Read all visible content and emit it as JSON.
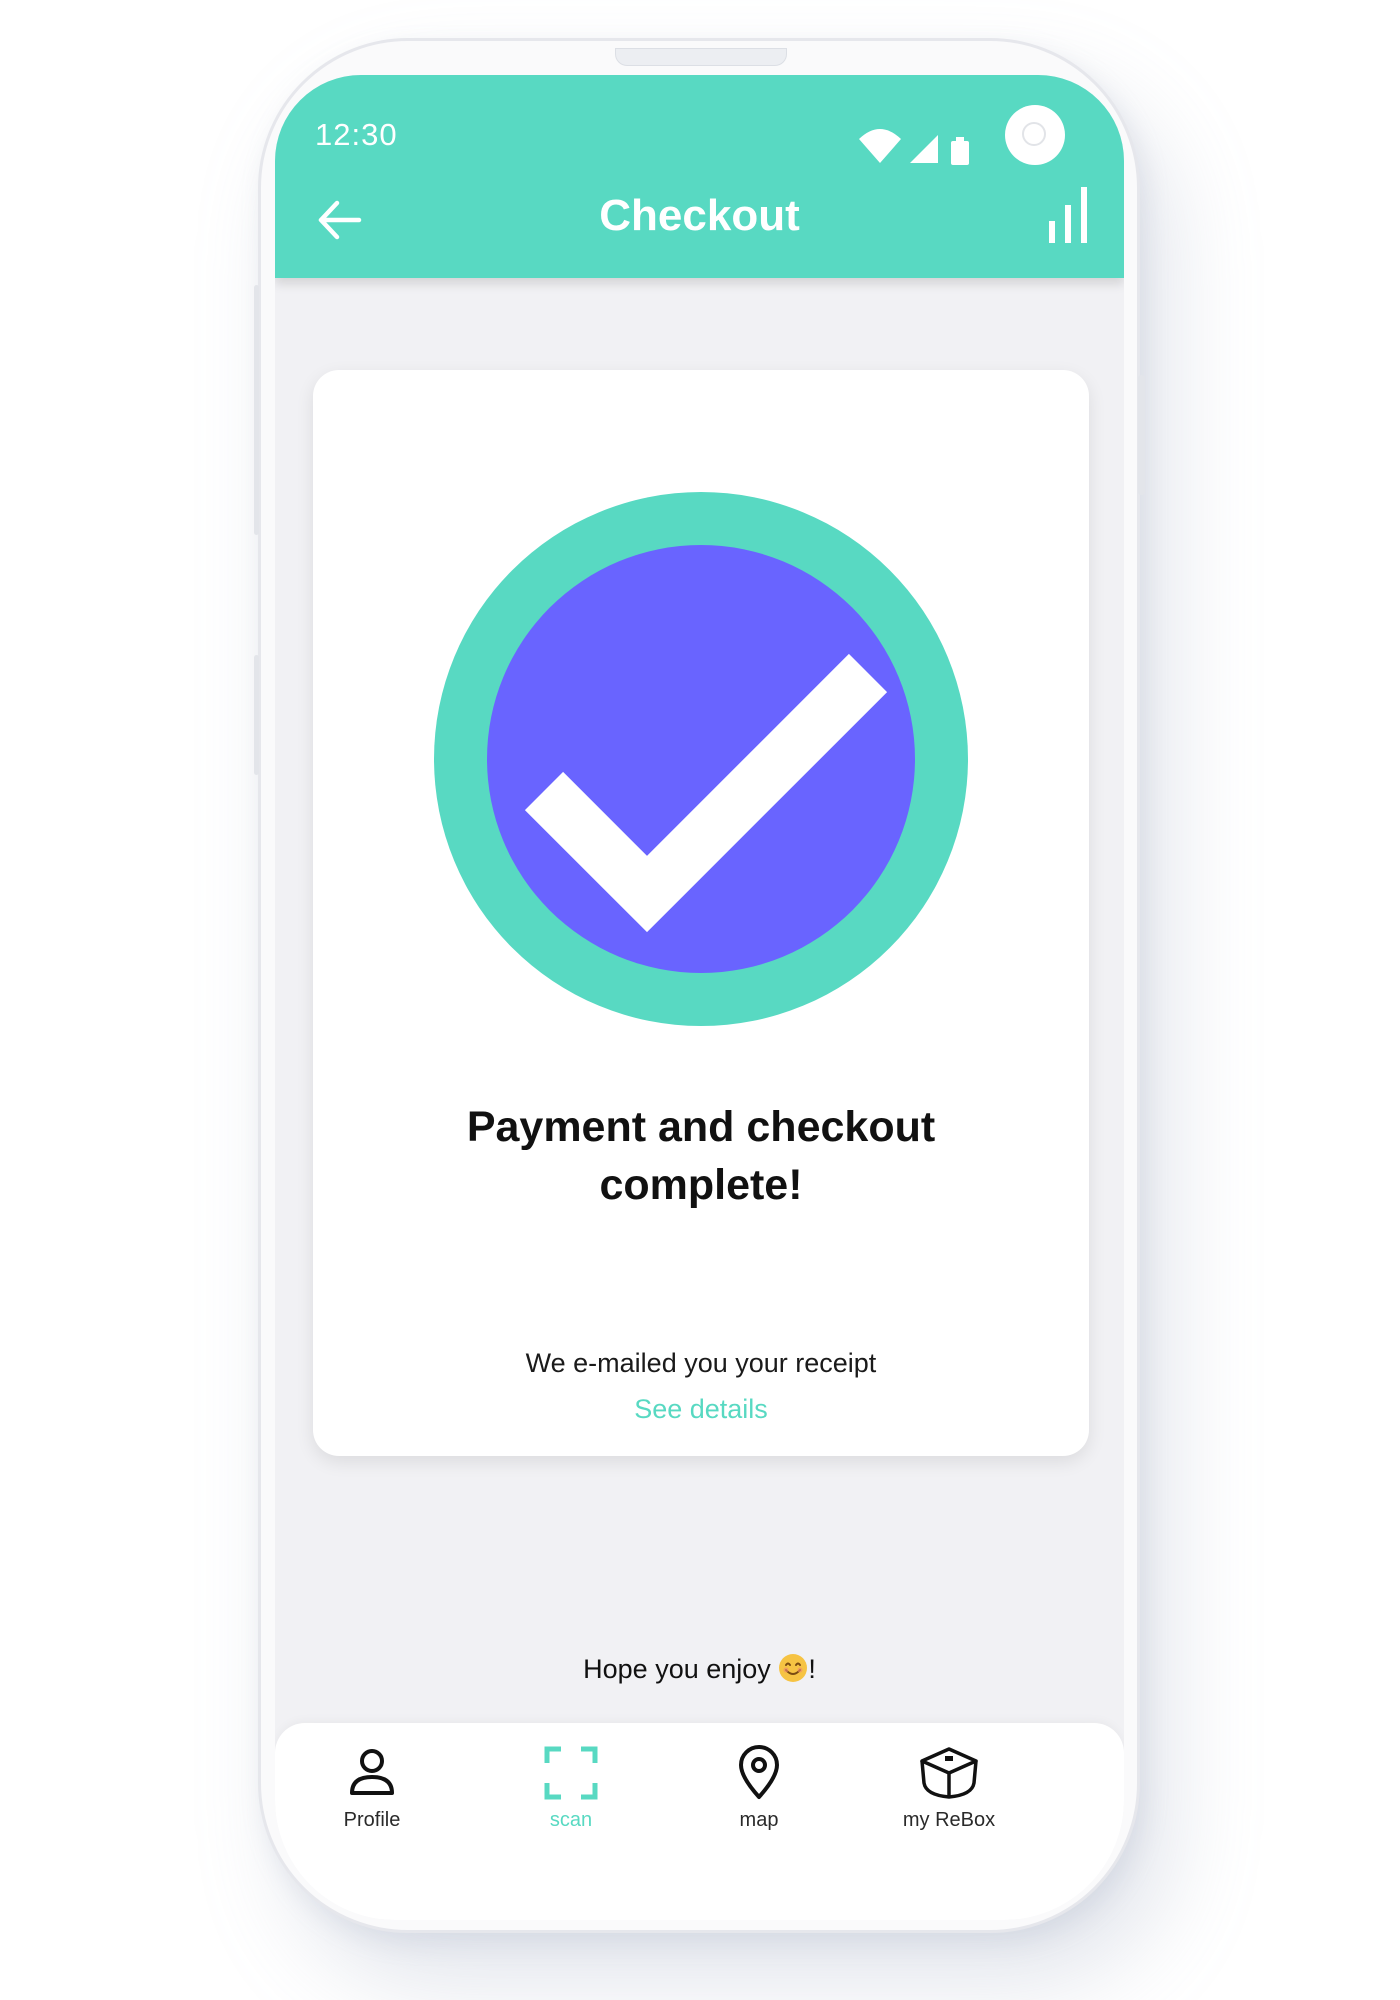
{
  "status_bar": {
    "time": "12:30"
  },
  "header": {
    "title": "Checkout"
  },
  "confirmation": {
    "headline_line1": "Payment and checkout",
    "headline_line2": "complete!",
    "receipt_text": "We e-mailed you your receipt",
    "details_link": "See details"
  },
  "footer_message": {
    "text": "Hope you enjoy",
    "suffix": "!"
  },
  "bottom_nav": {
    "items": [
      {
        "label": "Profile",
        "icon": "person-icon"
      },
      {
        "label": "scan",
        "icon": "scan-frame-icon",
        "active": true
      },
      {
        "label": "map",
        "icon": "map-pin-icon"
      },
      {
        "label": "my ReBox",
        "icon": "box-icon"
      }
    ]
  },
  "colors": {
    "accent": "#58d9c2",
    "check_inner": "#6964ff",
    "screen_bg": "#f1f1f4"
  }
}
